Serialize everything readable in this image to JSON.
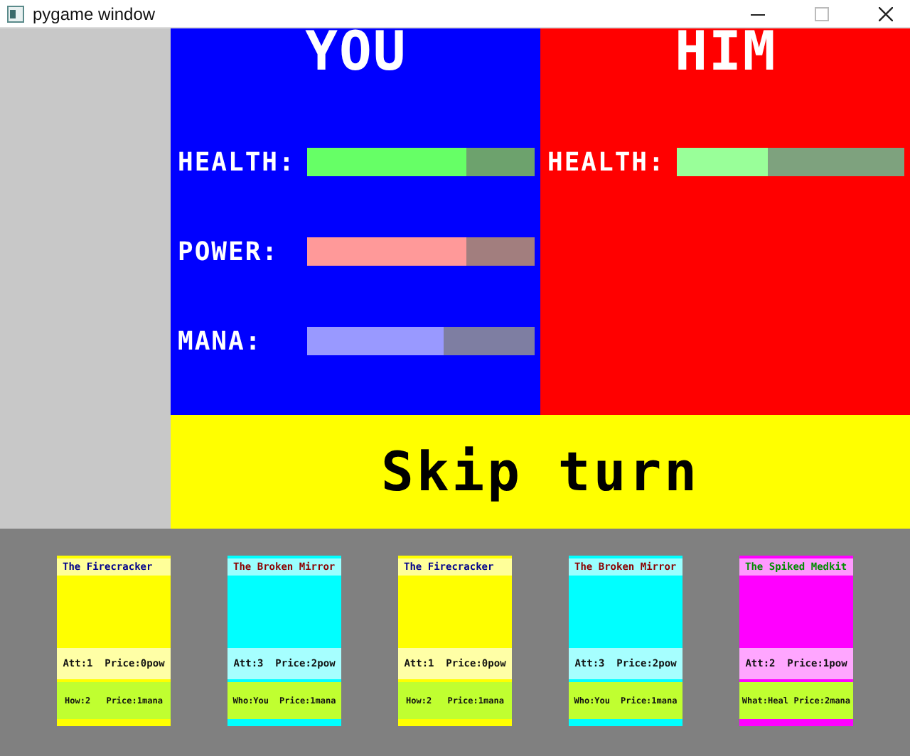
{
  "window": {
    "title": "pygame window"
  },
  "you": {
    "name": "YOU",
    "stats": [
      {
        "label": "HEALTH:",
        "level": 0.7,
        "color": "#66ff66"
      },
      {
        "label": "POWER:",
        "level": 0.7,
        "color": "#ff9999"
      },
      {
        "label": "MANA:",
        "level": 0.6,
        "color": "#9999ff"
      }
    ]
  },
  "him": {
    "name": "HIM",
    "stats": [
      {
        "label": "HEALTH:",
        "level": 0.4,
        "color": "#99ff99"
      }
    ]
  },
  "skip_button": "Skip turn",
  "cards": [
    {
      "title": "The Firecracker",
      "color": "#ffff00",
      "attack": "Att:1",
      "price": "Price:0pow",
      "effect": "How:2",
      "effect_price": "Price:1mana"
    },
    {
      "title": "The Broken Mirror",
      "color": "#00ffff",
      "attack": "Att:3",
      "price": "Price:2pow",
      "effect": "Who:You",
      "effect_price": "Price:1mana"
    },
    {
      "title": "The Firecracker",
      "color": "#ffff00",
      "attack": "Att:1",
      "price": "Price:0pow",
      "effect": "How:2",
      "effect_price": "Price:1mana"
    },
    {
      "title": "The Broken Mirror",
      "color": "#00ffff",
      "attack": "Att:3",
      "price": "Price:2pow",
      "effect": "Who:You",
      "effect_price": "Price:1mana"
    },
    {
      "title": "The Spiked Medkit",
      "color": "#ff00ff",
      "attack": "Att:2",
      "price": "Price:1pow",
      "effect": "What:Heal",
      "effect_price": "Price:2mana"
    }
  ]
}
